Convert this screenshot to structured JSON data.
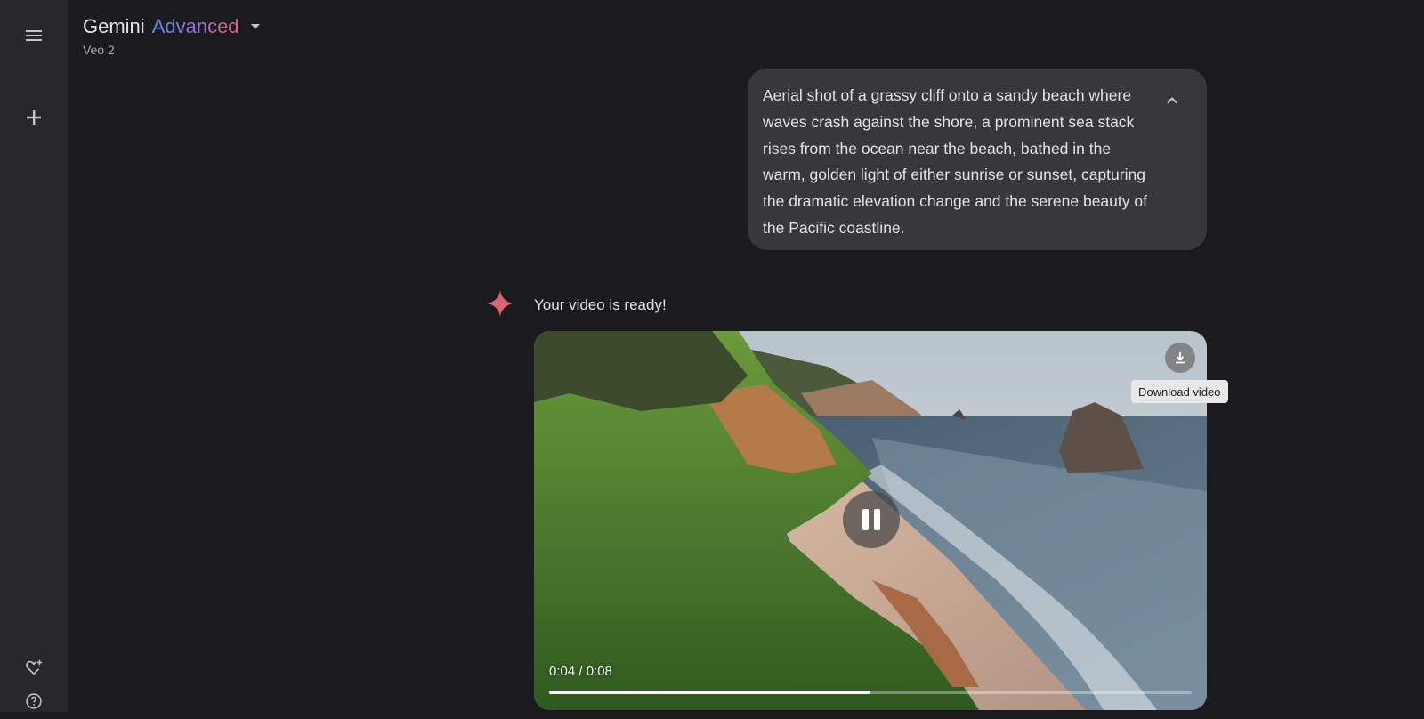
{
  "header": {
    "title": "Gemini",
    "tier": "Advanced",
    "model": "Veo 2"
  },
  "sidebar": {
    "menu_icon": "hamburger-menu-icon",
    "new_chat_icon": "plus-icon",
    "gems_icon": "gem-manager-icon",
    "help_icon": "help-icon"
  },
  "conversation": {
    "prompt": "Aerial shot of a grassy cliff onto a sandy beach where waves crash against the shore, a prominent sea stack rises from the ocean near the beach, bathed in the warm, golden light of either sunrise or sunset, capturing the dramatic elevation change and the serene beauty of the Pacific coastline.",
    "response": "Your video is ready!",
    "video": {
      "current_time": "0:04",
      "duration": "0:08",
      "time_display": "0:04 / 0:08",
      "progress_fraction": 0.5,
      "state": "playing",
      "download_tooltip": "Download video"
    }
  },
  "colors": {
    "background": "#1b1b1f",
    "rail": "#28282c",
    "prompt_bubble": "#37383b",
    "spark": "#d96570",
    "advanced_gradient_start": "#5a8bf0",
    "advanced_gradient_end": "#d96570"
  }
}
